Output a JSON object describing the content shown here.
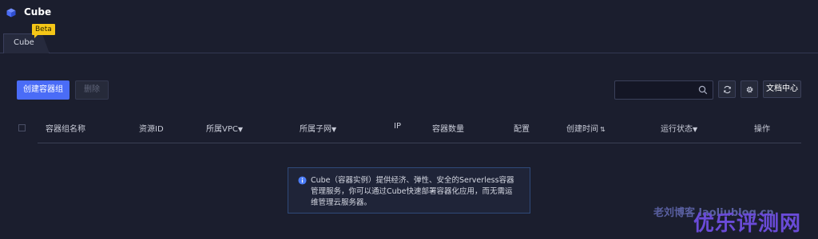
{
  "app": {
    "title": "Cube",
    "icon": "cube-icon"
  },
  "tabs": [
    {
      "label": "Cube",
      "badge": "Beta",
      "active": true
    }
  ],
  "toolbar": {
    "create_label": "创建容器组",
    "delete_label": "删除",
    "search_placeholder": "",
    "docs_label": "文档中心"
  },
  "table": {
    "columns": [
      "容器组名称",
      "资源ID",
      "所属VPC",
      "所属子网",
      "IP",
      "容器数量",
      "配置",
      "创建时间",
      "运行状态",
      "操作"
    ],
    "filter_marker": "▼",
    "sort_marker": "⇅"
  },
  "notice": {
    "text": "Cube（容器实例）提供经济、弹性、安全的Serverless容器管理服务，你可以通过Cube快速部署容器化应用，而无需运维管理云服务器。"
  },
  "watermark": {
    "small": "老刘博客 laoliublog.cn",
    "big": "优乐评测网"
  },
  "colors": {
    "background": "#1b1e2e",
    "primary": "#4a6cf7",
    "badge": "#f5c617",
    "notice_border": "#2f4a7a",
    "info": "#4a7cf7"
  }
}
